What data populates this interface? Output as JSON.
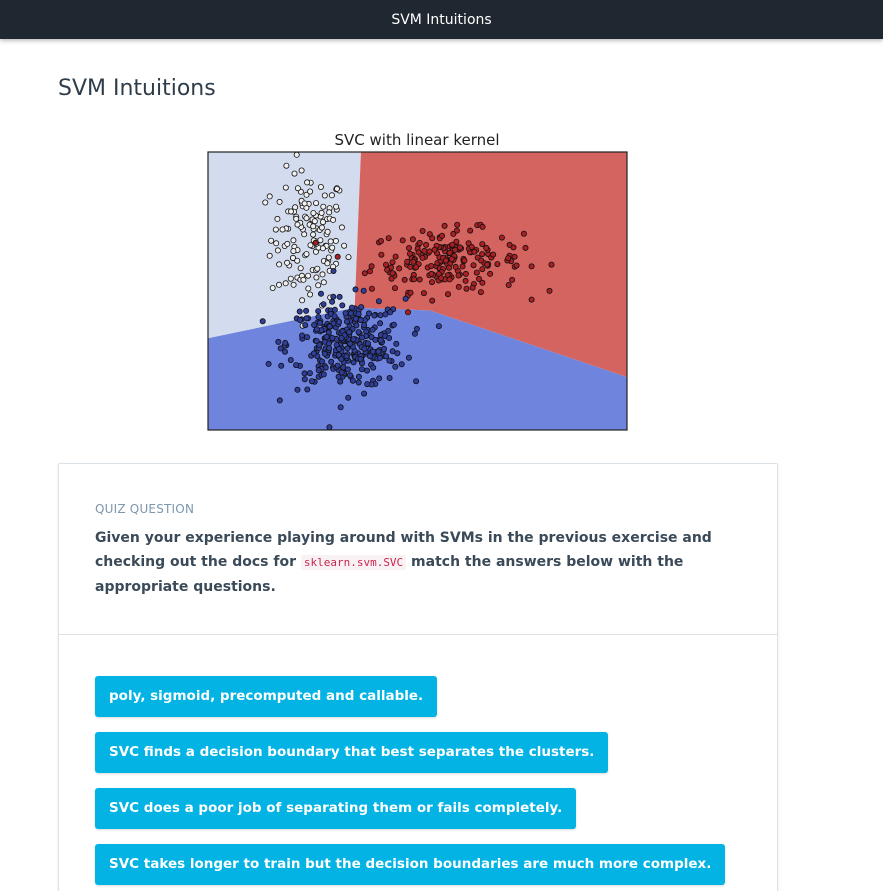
{
  "app": {
    "window_title": "SVM Intuitions"
  },
  "page": {
    "title": "SVM Intuitions"
  },
  "figure": {
    "colors": {
      "region_white": "#d3dcee",
      "region_red": "#d4645f",
      "region_blue": "#6f84dc",
      "point_white": "#f0f0f0",
      "point_red": "#a81f24",
      "point_blue": "#2f3e9a"
    },
    "chart_data": {
      "type": "scatter",
      "title": "SVC with linear kernel",
      "xlabel": "",
      "ylabel": "",
      "xlim": [
        0,
        100
      ],
      "ylim": [
        0,
        100
      ],
      "grid": false,
      "legend": "none",
      "decision_regions": [
        "white",
        "red",
        "blue"
      ],
      "series": [
        {
          "class": "white",
          "center": [
            24,
            69
          ],
          "spread": [
            4.5,
            12
          ],
          "count": 140
        },
        {
          "class": "red",
          "center": [
            57,
            61
          ],
          "spread": [
            9,
            5.5
          ],
          "count": 200
        },
        {
          "class": "blue",
          "center": [
            33,
            31
          ],
          "spread": [
            7,
            8
          ],
          "count": 320
        }
      ]
    }
  },
  "quiz": {
    "label": "QUIZ QUESTION",
    "question_pre": "Given your experience playing around with SVMs in the previous exercise and checking out the docs for ",
    "question_code": "sklearn.svm.SVC",
    "question_post": " match the answers below with the appropriate questions.",
    "answers": [
      "poly, sigmoid, precomputed and callable.",
      "SVC finds a decision boundary that best separates the clusters.",
      "SVC does a poor job of separating them or fails completely.",
      "SVC takes longer to train but the decision boundaries are much more complex."
    ]
  }
}
